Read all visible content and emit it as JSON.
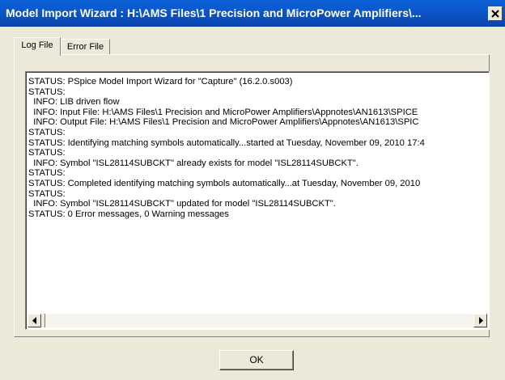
{
  "window": {
    "title": "Model Import Wizard : H:\\AMS Files\\1 Precision and MicroPower Amplifiers\\..."
  },
  "tabs": [
    {
      "label": "Log File",
      "active": true
    },
    {
      "label": "Error File",
      "active": false
    }
  ],
  "log": {
    "lines": [
      "STATUS: PSpice Model Import Wizard for \"Capture\" (16.2.0.s003)",
      "STATUS:",
      "  INFO: LIB driven flow",
      "  INFO: Input File: H:\\AMS Files\\1 Precision and MicroPower Amplifiers\\Appnotes\\AN1613\\SPICE",
      "  INFO: Output File: H:\\AMS Files\\1 Precision and MicroPower Amplifiers\\Appnotes\\AN1613\\SPIC",
      "STATUS:",
      "STATUS: Identifying matching symbols automatically...started at Tuesday, November 09, 2010 17:4",
      "STATUS:",
      "  INFO: Symbol \"ISL28114SUBCKT\" already exists for model \"ISL28114SUBCKT\".",
      "STATUS:",
      "STATUS: Completed identifying matching symbols automatically...at Tuesday, November 09, 2010",
      "STATUS:",
      "  INFO: Symbol \"ISL28114SUBCKT\" updated for model \"ISL28114SUBCKT\".",
      "STATUS: 0 Error messages, 0 Warning messages"
    ]
  },
  "buttons": {
    "ok_label": "OK"
  },
  "icons": {
    "close": "close-icon",
    "scroll_left": "arrow-left-icon",
    "scroll_right": "arrow-right-icon"
  },
  "colors": {
    "titlebar": "#0a5fd6",
    "face": "#ece9d8"
  }
}
